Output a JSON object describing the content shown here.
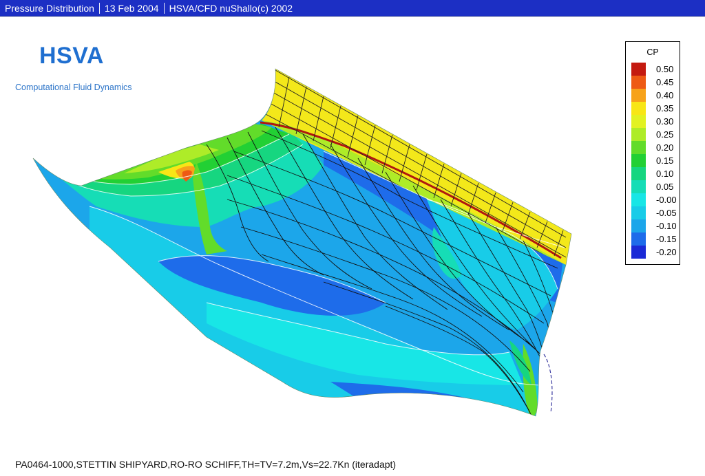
{
  "titlebar": {
    "items": [
      "Pressure Distribution",
      "13 Feb 2004",
      "HSVA/CFD nuShallo(c) 2002"
    ]
  },
  "logo": "HSVA",
  "subtitle": "Computational Fluid Dynamics",
  "footer": "PA0464-1000,STETTIN SHIPYARD,RO-RO SCHIFF,TH=TV=7.2m,Vs=22.7Kn (iteradapt)",
  "chart_data": {
    "type": "heatmap",
    "legend_title": "CP",
    "legend_placement": "top-right",
    "levels": [
      {
        "label": "0.50",
        "color": "#c41a10"
      },
      {
        "label": "0.45",
        "color": "#ee5a14"
      },
      {
        "label": "0.40",
        "color": "#f7a21a"
      },
      {
        "label": "0.35",
        "color": "#f8e616"
      },
      {
        "label": "0.30",
        "color": "#e2f222"
      },
      {
        "label": "0.25",
        "color": "#aeec28"
      },
      {
        "label": "0.20",
        "color": "#62dc2a"
      },
      {
        "label": "0.15",
        "color": "#22d034"
      },
      {
        "label": "0.10",
        "color": "#16d680"
      },
      {
        "label": "0.05",
        "color": "#16ddb6"
      },
      {
        "label": "-0.00",
        "color": "#18e6e6"
      },
      {
        "label": "-0.05",
        "color": "#18cce8"
      },
      {
        "label": "-0.10",
        "color": "#1ca6ea"
      },
      {
        "label": "-0.15",
        "color": "#1e6cea"
      },
      {
        "label": "-0.20",
        "color": "#1b2ad6"
      }
    ]
  }
}
